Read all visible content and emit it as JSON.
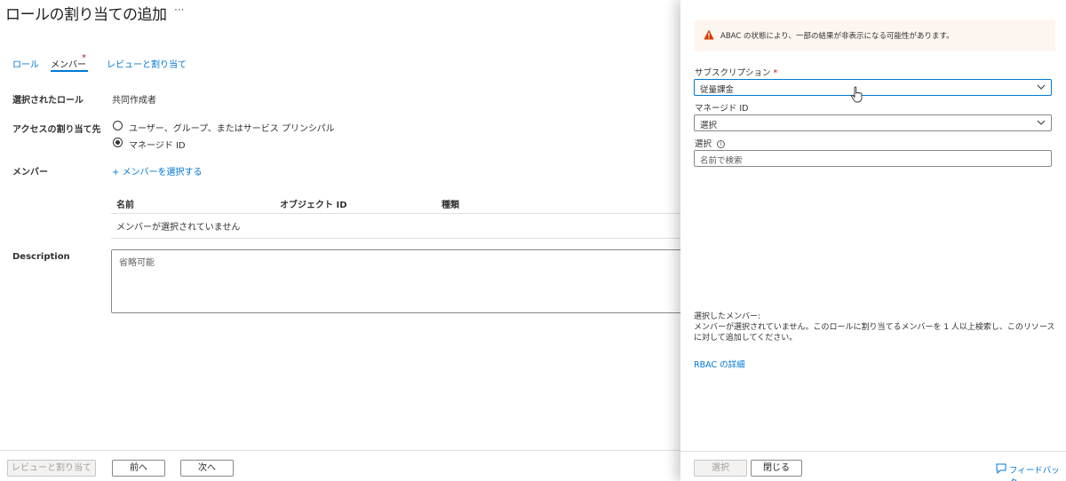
{
  "page": {
    "title": "ロールの割り当ての追加",
    "more": "···"
  },
  "tabs": [
    {
      "label": "ロール",
      "active": false
    },
    {
      "label": "メンバー",
      "active": true,
      "required_mark": "*"
    },
    {
      "label": "レビューと割り当て",
      "active": false
    }
  ],
  "form": {
    "selected_role_label": "選択されたロール",
    "selected_role_value": "共同作成者",
    "assign_access_label": "アクセスの割り当て先",
    "option_user_group": "ユーザー、グループ、またはサービス プリンシパル",
    "option_managed_id": "マネージド ID",
    "selected_option": "option_managed_id",
    "members_label": "メンバー",
    "select_members_link": "+ メンバーを選択する",
    "table": {
      "columns": [
        "名前",
        "オブジェクト ID",
        "種類"
      ],
      "empty_text": "メンバーが選択されていません"
    },
    "description_label": "Description",
    "description_placeholder": "省略可能"
  },
  "footer": {
    "review_assign": "レビューと割り当て",
    "previous": "前へ",
    "next": "次へ"
  },
  "panel": {
    "warning_text": "ABAC の状態により、一部の結果が非表示になる可能性があります。",
    "subscription_label": "サブスクリプション",
    "required_mark": "*",
    "subscription_value": "従量課金",
    "managed_id_label": "マネージド ID",
    "managed_id_value": "選択",
    "select_label": "選択",
    "search_placeholder": "名前で検索",
    "selected_members_title": "選択したメンバー:",
    "selected_members_text": "メンバーが選択されていません。このロールに割り当てるメンバーを 1 人以上検索し、このリソースに対して追加してください。",
    "rbac_link": "RBAC の詳細",
    "select_button": "選択",
    "close_button": "閉じる",
    "feedback": "フィードバック"
  },
  "colors": {
    "accent": "#0078d4",
    "warning": "#d83b01",
    "required": "#c50f1f"
  }
}
